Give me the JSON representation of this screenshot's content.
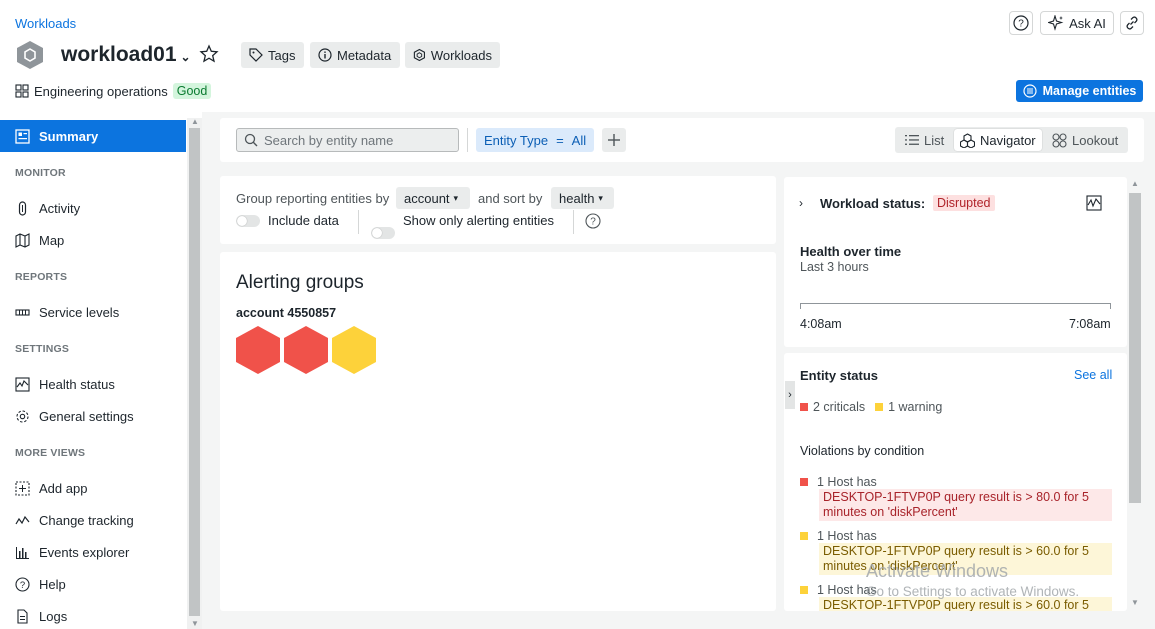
{
  "header": {
    "breadcrumb": "Workloads",
    "title": "workload01",
    "pills": {
      "tags": "Tags",
      "metadata": "Metadata",
      "workloads": "Workloads"
    },
    "ask_ai": "Ask AI",
    "team": "Engineering operations",
    "team_status": "Good",
    "manage_entities": "Manage entities"
  },
  "sidebar": {
    "summary": "Summary",
    "sections": {
      "monitor": "MONITOR",
      "reports": "REPORTS",
      "settings": "SETTINGS",
      "more_views": "MORE VIEWS"
    },
    "items": {
      "activity": "Activity",
      "map": "Map",
      "service_levels": "Service levels",
      "health_status": "Health status",
      "general_settings": "General settings",
      "add_app": "Add app",
      "change_tracking": "Change tracking",
      "events_explorer": "Events explorer",
      "help": "Help",
      "logs": "Logs"
    }
  },
  "toolbar": {
    "search_placeholder": "Search by entity name",
    "entity_type_label": "Entity Type",
    "entity_type_op": "=",
    "entity_type_value": "All",
    "views": {
      "list": "List",
      "navigator": "Navigator",
      "lookout": "Lookout"
    },
    "selected_view": "navigator"
  },
  "grouping": {
    "group_label": "Group reporting entities by",
    "group_value": "account",
    "sort_label": "and sort by",
    "sort_value": "health",
    "include_data": "Include data",
    "only_alerting": "Show only alerting entities"
  },
  "alerting": {
    "title": "Alerting groups",
    "account": "account 4550857",
    "hexagons": [
      {
        "status": "critical",
        "color": "#f0524a"
      },
      {
        "status": "critical",
        "color": "#f0524a"
      },
      {
        "status": "warning",
        "color": "#fdd23a"
      }
    ]
  },
  "workload_status": {
    "label": "Workload status:",
    "value": "Disrupted",
    "health_title": "Health over time",
    "period": "Last 3 hours",
    "start_time": "4:08am",
    "end_time": "7:08am"
  },
  "entity_status": {
    "title": "Entity status",
    "see_all": "See all",
    "criticals": "2 criticals",
    "warnings": "1 warning",
    "violations_title": "Violations by condition",
    "violations": [
      {
        "severity": "crit",
        "head": "1 Host has",
        "msg": "DESKTOP-1FTVP0P query result is > 80.0 for 5 minutes on 'diskPercent'"
      },
      {
        "severity": "warn",
        "head": "1 Host has",
        "msg": "DESKTOP-1FTVP0P query result is > 60.0 for 5 minutes on 'diskPercent'"
      },
      {
        "severity": "warn",
        "head": "1 Host has",
        "msg": "DESKTOP-1FTVP0P query result is > 60.0 for 5"
      }
    ]
  },
  "colors": {
    "accent": "#0c74df",
    "critical": "#f0524a",
    "warning": "#fdd23a"
  },
  "watermark": {
    "line1": "Activate Windows",
    "line2": "Go to Settings to activate Windows."
  }
}
